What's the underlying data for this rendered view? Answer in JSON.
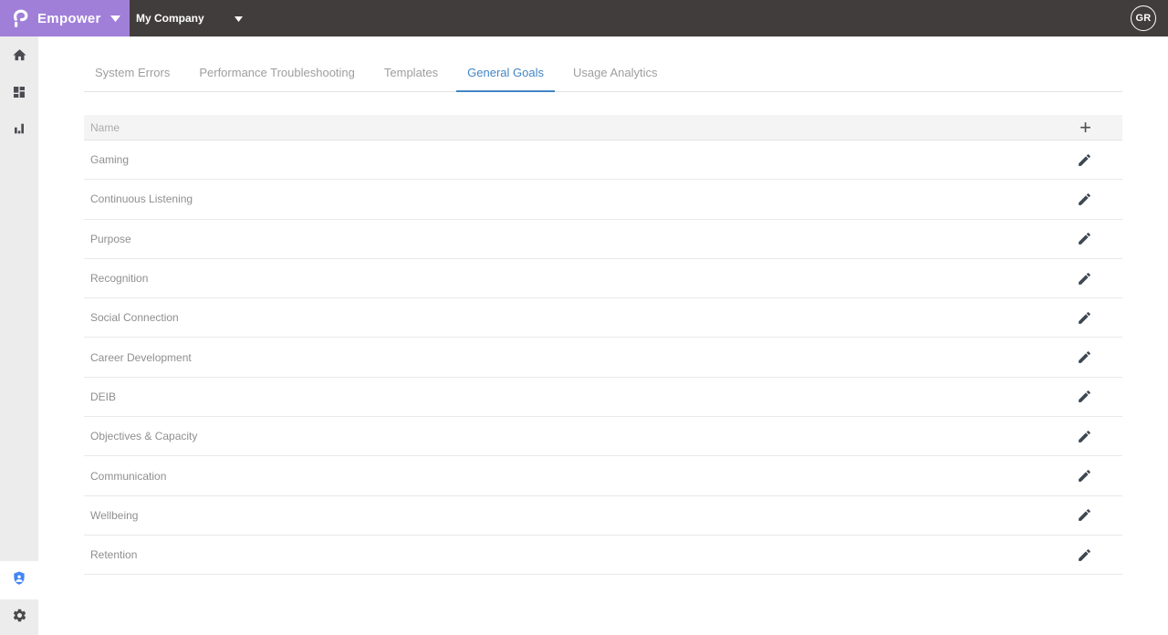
{
  "topbar": {
    "brand": "Empower",
    "company_selector": {
      "value": "My Company"
    },
    "avatar_initials": "GR"
  },
  "sidebar": {
    "items": [
      {
        "name": "home",
        "icon": "home-icon"
      },
      {
        "name": "dashboard",
        "icon": "dashboard-icon"
      },
      {
        "name": "analytics",
        "icon": "bar-chart-icon"
      }
    ],
    "bottom_items": [
      {
        "name": "admin",
        "icon": "admin-shield-icon"
      },
      {
        "name": "settings",
        "icon": "gear-icon"
      }
    ]
  },
  "tabs": [
    {
      "label": "System Errors",
      "active": false
    },
    {
      "label": "Performance Troubleshooting",
      "active": false
    },
    {
      "label": "Templates",
      "active": false
    },
    {
      "label": "General Goals",
      "active": true
    },
    {
      "label": "Usage Analytics",
      "active": false
    }
  ],
  "goals_table": {
    "column_header": "Name",
    "add_button": "+",
    "rows": [
      "Gaming",
      "Continuous Listening",
      "Purpose",
      "Recognition",
      "Social Connection",
      "Career Development",
      "DEIB",
      "Objectives & Capacity",
      "Communication",
      "Wellbeing",
      "Retention"
    ]
  },
  "colors": {
    "brand_purple": "#A07FD9",
    "topbar_dark": "#413D3C",
    "sidebar_gray": "#ECECEC",
    "active_tab_blue": "#4285C4",
    "admin_icon_blue": "#4285F4",
    "row_text_gray": "#8F8F8F"
  }
}
